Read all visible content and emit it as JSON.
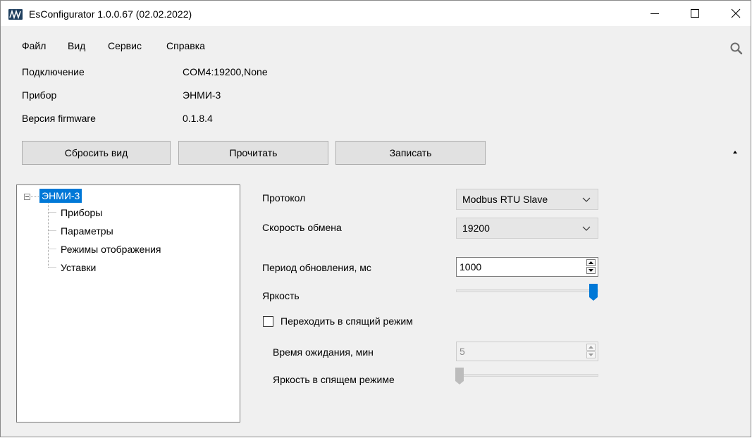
{
  "window": {
    "title": "EsConfigurator 1.0.0.67 (02.02.2022)"
  },
  "menu": {
    "items": [
      "Файл",
      "Вид",
      "Сервис",
      "Справка"
    ]
  },
  "info": [
    {
      "label": "Подключение",
      "value": "COM4:19200,None"
    },
    {
      "label": "Прибор",
      "value": "ЭНМИ-3"
    },
    {
      "label": "Версия firmware",
      "value": "0.1.8.4"
    }
  ],
  "toolbar": {
    "reset_label": "Сбросить вид",
    "read_label": "Прочитать",
    "write_label": "Записать"
  },
  "tree": {
    "root": "ЭНМИ-3",
    "children": [
      "Приборы",
      "Параметры",
      "Режимы отображения",
      "Уставки"
    ]
  },
  "settings": {
    "protocol_label": "Протокол",
    "protocol_value": "Modbus RTU Slave",
    "baud_label": "Скорость обмена",
    "baud_value": "19200",
    "period_label": "Период обновления, мс",
    "period_value": "1000",
    "brightness_label": "Яркость",
    "brightness_level": 1.0,
    "sleep_label": "Переходить в спящий режим",
    "sleep_checked": false,
    "wait_label": "Время ожидания, мин",
    "wait_value": "5",
    "sleep_brightness_label": "Яркость в спящем режиме",
    "sleep_brightness_level": 0.0
  },
  "colors": {
    "accent": "#0078d7",
    "selection_bg": "#0078d7",
    "disabled_thumb": "#bcbcbc"
  },
  "icons": {
    "app": "esconfigurator-logo-icon",
    "search": "search-icon",
    "collapse": "collapse-up-icon"
  }
}
